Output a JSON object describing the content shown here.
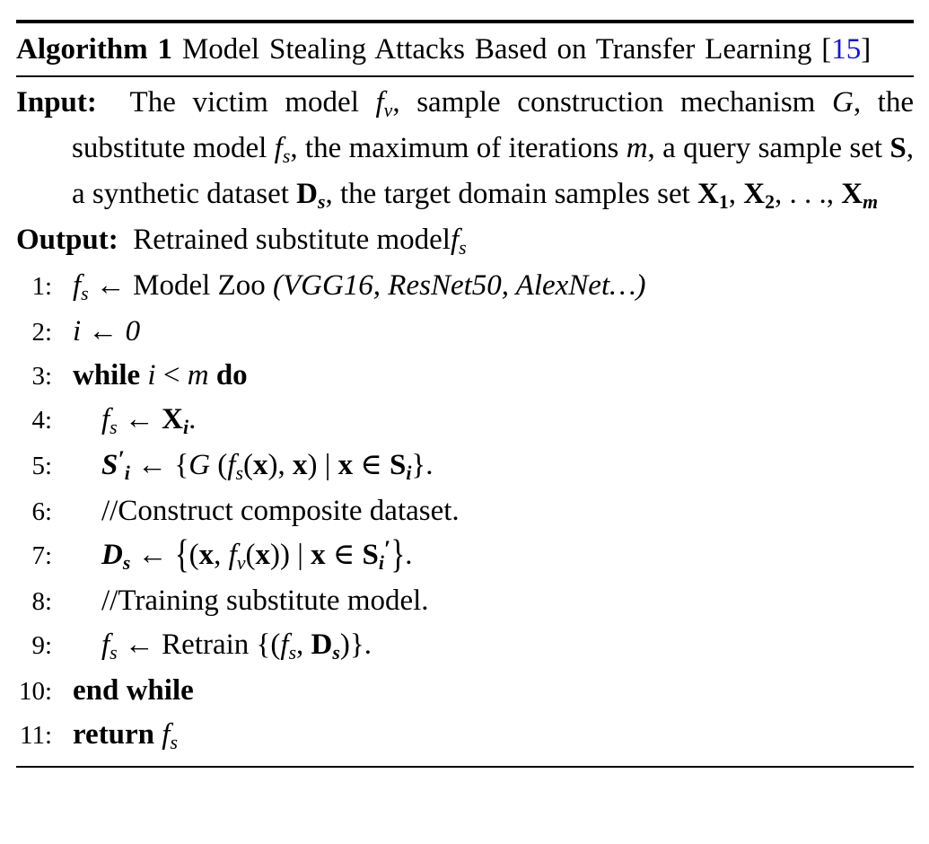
{
  "document": {
    "type": "algorithm-float",
    "background_color": "#ffffff",
    "text_color": "#000000",
    "citation_color": "#1414e6"
  },
  "caption": {
    "label": "Algorithm 1",
    "title": "Model Stealing Attacks Based on Transfer Learning",
    "citation_open": " [",
    "citation": "15",
    "citation_close": "]"
  },
  "io": {
    "input_label": "Input:",
    "input_text_line1": "The victim model f",
    "input_text": "The victim model f_v, sample construction mechanism G, the substitute model f_s, the maximum of iterations m, a query sample set S, a synthetic dataset D_s, the target domain samples set X_1, X_2, ..., X_m",
    "output_label": "Output:",
    "output_text": "Retrained substitute model f_s"
  },
  "lines": [
    {
      "num": "1:",
      "text": "f_s <- Model Zoo (VGG16, ResNet50, AlexNet...)"
    },
    {
      "num": "2:",
      "text": "i <- 0"
    },
    {
      "num": "3:",
      "text": "while i < m do"
    },
    {
      "num": "4:",
      "text": "f_s <- X_i."
    },
    {
      "num": "5:",
      "text": "S'_i <- {G (f_s(x), x) | x in S_i}."
    },
    {
      "num": "6:",
      "text": "//Construct composite dataset."
    },
    {
      "num": "7:",
      "text": "D_s <- {(x, f_v(x)) | x in S_i'}."
    },
    {
      "num": "8:",
      "text": "//Training substitute model."
    },
    {
      "num": "9:",
      "text": "f_s <- Retrain {(f_s, D_s)}."
    },
    {
      "num": "10:",
      "text": "end while"
    },
    {
      "num": "11:",
      "text": "return f_s"
    }
  ],
  "tokens": {
    "arrow": "←",
    "in": "∈",
    "lt": "<",
    "pipe": "|",
    "ellipsis": "…",
    "ldots": ". . .",
    "lbrace": "{",
    "rbrace": "}",
    "prime": "′"
  },
  "keywords": {
    "while": "while",
    "do": "do",
    "end_while": "end while",
    "return": "return"
  },
  "line_texts": {
    "l1_prefix": "Model Zoo ",
    "l1_models": "(VGG16, ResNet50, AlexNet",
    "l1_models_end": ")",
    "l2_value": "0",
    "l6_comment": "//Construct composite dataset.",
    "l8_comment": "//Training substitute model.",
    "l9_retrain": "Retrain ",
    "io_in_1": "The victim model ",
    "io_in_2": ", sample construction mechanism ",
    "io_in_3": ", the substitute model ",
    "io_in_4": ", the maximum of iterations ",
    "io_in_5": ", a query sample set ",
    "io_in_6": ", a synthetic dataset ",
    "io_in_7": ", the target domain samples set ",
    "io_out_1": "Retrained substitute model"
  },
  "symbols": {
    "f": "f",
    "v": "v",
    "s": "s",
    "G": "G",
    "m": "m",
    "i": "i",
    "S": "S",
    "D": "D",
    "X": "X",
    "x": "x",
    "one": "1",
    "two": "2"
  }
}
